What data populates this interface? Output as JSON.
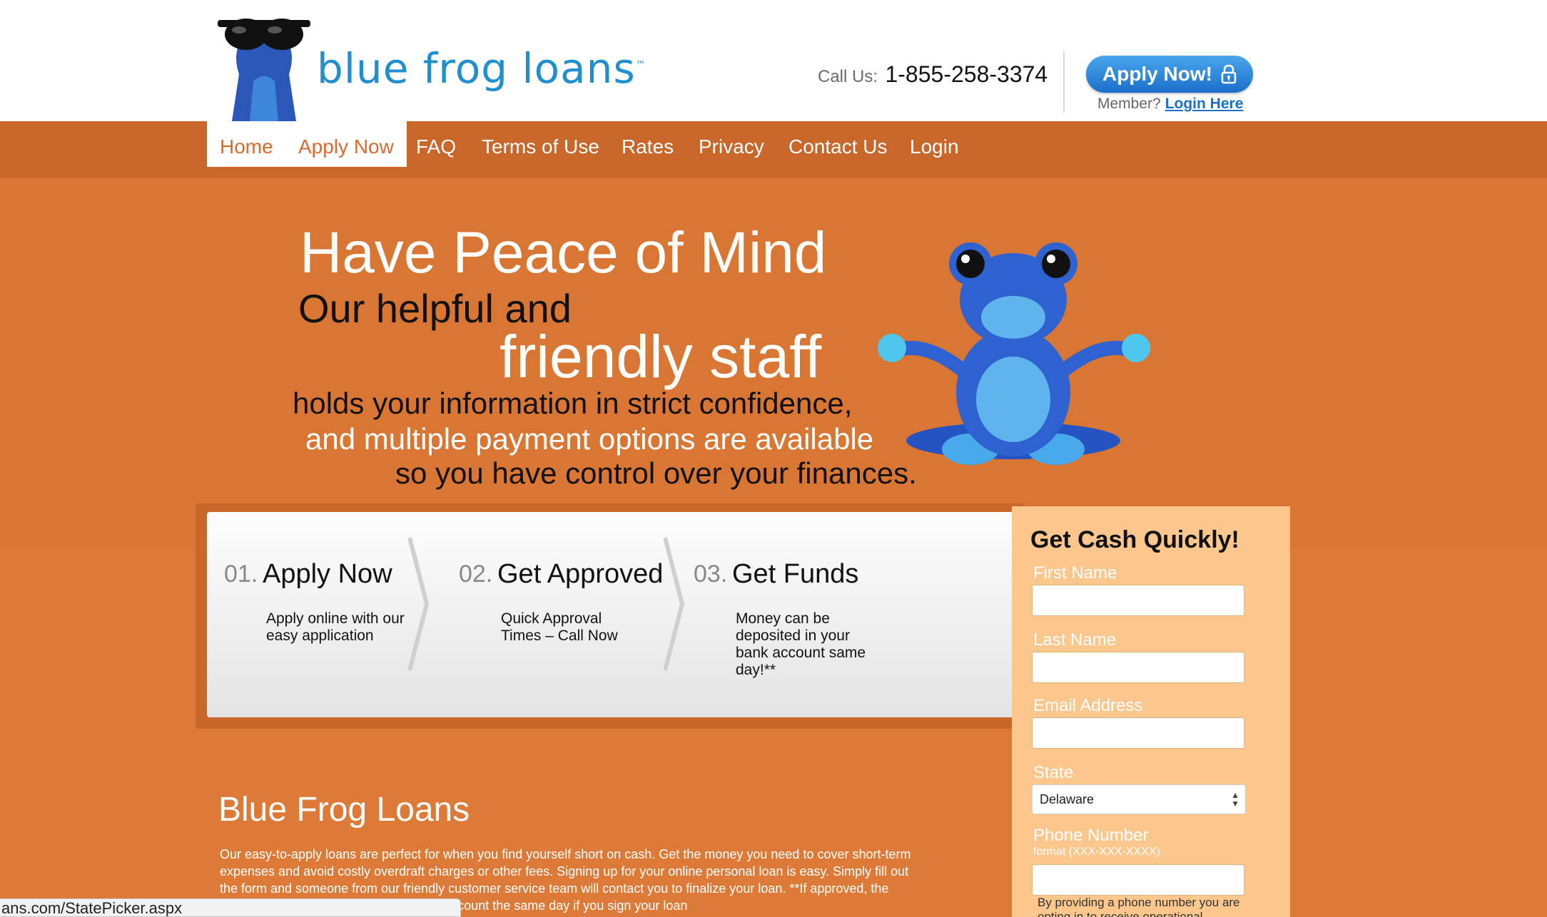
{
  "header": {
    "logo_text": "blue frog loans",
    "call_label": "Call Us:",
    "phone": "1-855-258-3374",
    "apply_button": "Apply Now!",
    "member_label": "Member?",
    "login_link": "Login Here"
  },
  "nav": {
    "items": [
      {
        "label": "Home"
      },
      {
        "label": "Apply Now"
      },
      {
        "label": "FAQ"
      },
      {
        "label": "Terms of Use"
      },
      {
        "label": "Rates"
      },
      {
        "label": "Privacy"
      },
      {
        "label": "Contact Us"
      },
      {
        "label": "Login"
      }
    ]
  },
  "hero": {
    "line1": "Have Peace of Mind",
    "line2": "Our helpful and",
    "line3": "friendly staff",
    "line4": "holds your information in strict confidence,",
    "line5": "and multiple payment options are available",
    "line6": "so you have control over your finances."
  },
  "steps": [
    {
      "num": "01.",
      "title": "Apply Now",
      "desc": "Apply online with our easy application"
    },
    {
      "num": "02.",
      "title": "Get Approved",
      "desc": "Quick Approval Times – Call Now"
    },
    {
      "num": "03.",
      "title": "Get Funds",
      "desc": "Money can be deposited in your bank account same day!**"
    }
  ],
  "form": {
    "title": "Get Cash Quickly!",
    "first_name_label": "First Name",
    "last_name_label": "Last Name",
    "email_label": "Email Address",
    "state_label": "State",
    "state_value": "Delaware",
    "phone_label": "Phone Number",
    "phone_format": "format (XXX-XXX-XXXX)",
    "note": "By providing a phone number you are opting in to receive operational"
  },
  "about": {
    "title": "Blue Frog Loans",
    "text": "Our easy-to-apply loans are perfect for when you find yourself short on cash. Get the money you need to cover short-term expenses and avoid costly overdraft charges or other fees. Signing up for your online personal loan is easy. Simply fill out the form and someone from our friendly customer service team will contact you to finalize your loan. **If approved, the funds may be deposited into your bank account the same day if you sign your loan"
  },
  "status_bar": "ans.com/StatePicker.aspx",
  "colors": {
    "brand_blue": "#1f8fd0",
    "nav_orange": "#c9662a",
    "hero_orange": "#d97634",
    "page_orange": "#de7a38",
    "form_peach": "#fbc78c"
  }
}
